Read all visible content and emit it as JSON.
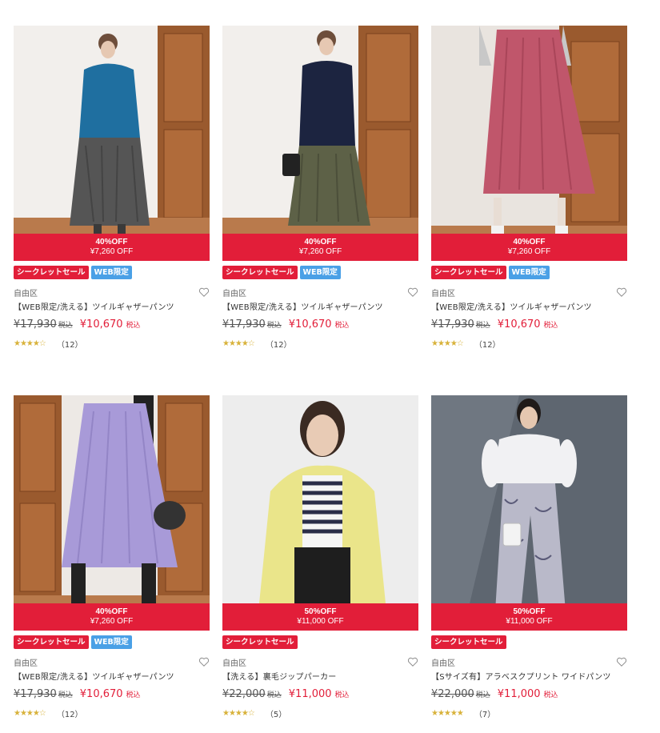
{
  "colors": {
    "sale_red": "#e21e39",
    "web_blue": "#4aa0e6",
    "star_gold": "#d8b23a"
  },
  "products": [
    {
      "discount_pct": "40%OFF",
      "discount_amount": "¥7,260 OFF",
      "badges": [
        "シークレットセール",
        "WEB限定"
      ],
      "brand": "自由区",
      "name": "【WEB限定/洗える】ツイルギャザーパンツ",
      "price_old": "¥17,930",
      "tax_old": "税込",
      "price_new": "¥10,670",
      "tax_new": "税込",
      "stars": "★★★★☆",
      "rating": 4.5,
      "review_count": "（12）",
      "image_desc": "woman in blue hoodie and grey gaucho pants",
      "icon": "heart-icon"
    },
    {
      "discount_pct": "40%OFF",
      "discount_amount": "¥7,260 OFF",
      "badges": [
        "シークレットセール",
        "WEB限定"
      ],
      "brand": "自由区",
      "name": "【WEB限定/洗える】ツイルギャザーパンツ",
      "price_old": "¥17,930",
      "tax_old": "税込",
      "price_new": "¥10,670",
      "tax_new": "税込",
      "stars": "★★★★☆",
      "rating": 4.5,
      "review_count": "（12）",
      "icon": "heart-icon"
    },
    {
      "discount_pct": "40%OFF",
      "discount_amount": "¥7,260 OFF",
      "badges": [
        "シークレットセール",
        "WEB限定"
      ],
      "brand": "自由区",
      "name": "【WEB限定/洗える】ツイルギャザーパンツ",
      "price_old": "¥17,930",
      "tax_old": "税込",
      "price_new": "¥10,670",
      "tax_new": "税込",
      "stars": "★★★★☆",
      "rating": 4.5,
      "review_count": "（12）",
      "icon": "heart-icon"
    },
    {
      "discount_pct": "40%OFF",
      "discount_amount": "¥7,260 OFF",
      "badges": [
        "シークレットセール",
        "WEB限定"
      ],
      "brand": "自由区",
      "name": "【WEB限定/洗える】ツイルギャザーパンツ",
      "price_old": "¥17,930",
      "tax_old": "税込",
      "price_new": "¥10,670",
      "tax_new": "税込",
      "stars": "★★★★☆",
      "rating": 4.5,
      "review_count": "（12）",
      "icon": "heart-icon"
    },
    {
      "discount_pct": "50%OFF",
      "discount_amount": "¥11,000 OFF",
      "badges": [
        "シークレットセール"
      ],
      "brand": "自由区",
      "name": "【洗える】裏毛ジップパーカー",
      "price_old": "¥22,000",
      "tax_old": "税込",
      "price_new": "¥11,000",
      "tax_new": "税込",
      "stars": "★★★★☆",
      "rating": 4.5,
      "review_count": "（5）",
      "icon": "heart-icon"
    },
    {
      "discount_pct": "50%OFF",
      "discount_amount": "¥11,000 OFF",
      "badges": [
        "シークレットセール"
      ],
      "brand": "自由区",
      "name": "【Sサイズ有】アラベスクプリント ワイドパンツ",
      "price_old": "¥22,000",
      "tax_old": "税込",
      "price_new": "¥11,000",
      "tax_new": "税込",
      "stars": "★★★★★",
      "rating": 5,
      "review_count": "（7）",
      "icon": "heart-icon"
    }
  ]
}
